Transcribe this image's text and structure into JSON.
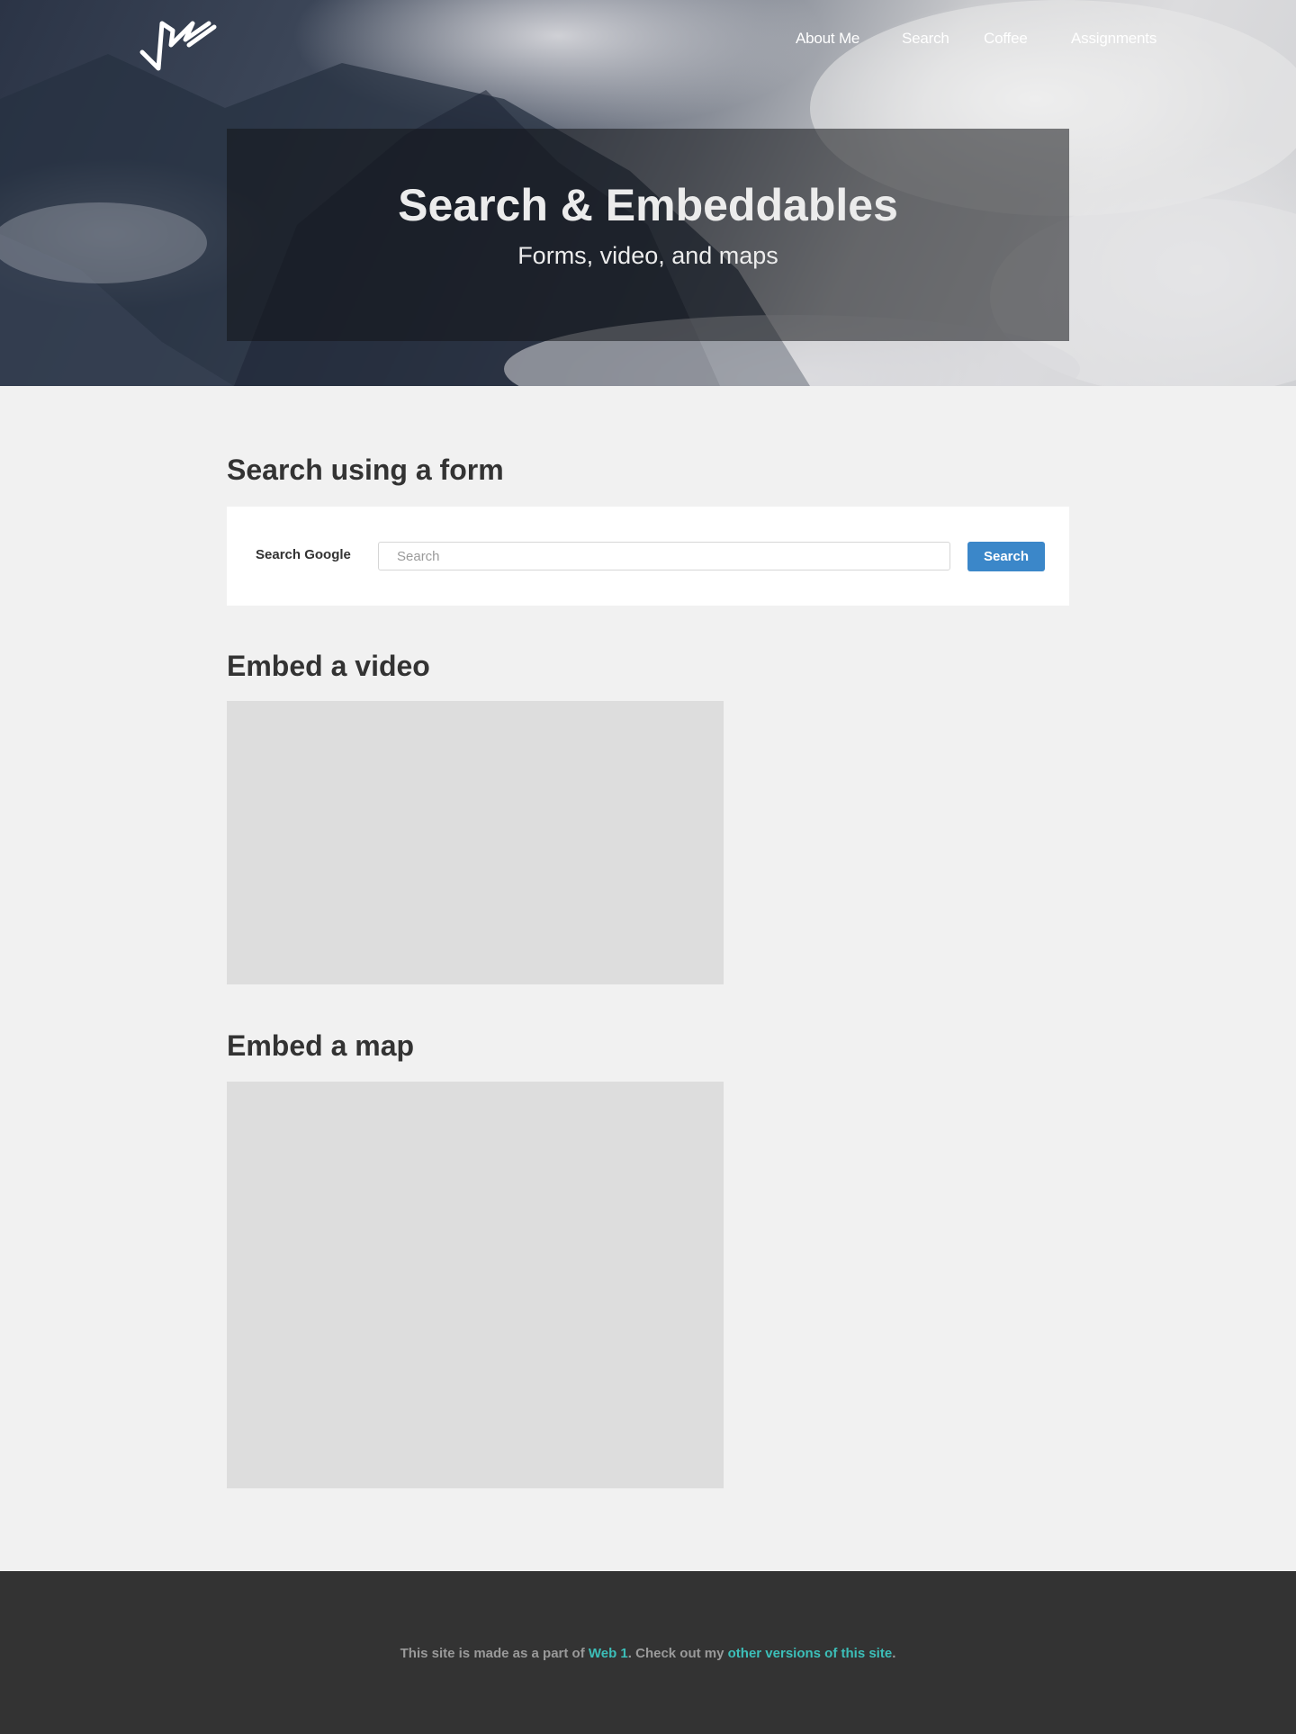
{
  "header": {
    "logo_icon": "signature-logo-icon",
    "nav": [
      {
        "label": "About Me"
      },
      {
        "label": "Search"
      },
      {
        "label": "Coffee"
      },
      {
        "label": "Assignments"
      }
    ]
  },
  "hero": {
    "title": "Search & Embeddables",
    "subtitle": "Forms, video, and maps"
  },
  "search_section": {
    "heading": "Search using a form",
    "label": "Search Google",
    "input_value": "",
    "input_placeholder": "Search",
    "button_label": "Search"
  },
  "video_section": {
    "heading": "Embed a video"
  },
  "map_section": {
    "heading": "Embed a map"
  },
  "footer": {
    "text_before": "This site is made as a part of ",
    "link1": "Web 1",
    "text_middle": ". Check out my ",
    "link2": "other versions of this site",
    "text_after": "."
  },
  "colors": {
    "page_background": "#f1f1f1",
    "footer_background": "#333333",
    "accent_button": "#3b87c9",
    "footer_link": "#3cbfb9",
    "heading_text": "#333333"
  }
}
